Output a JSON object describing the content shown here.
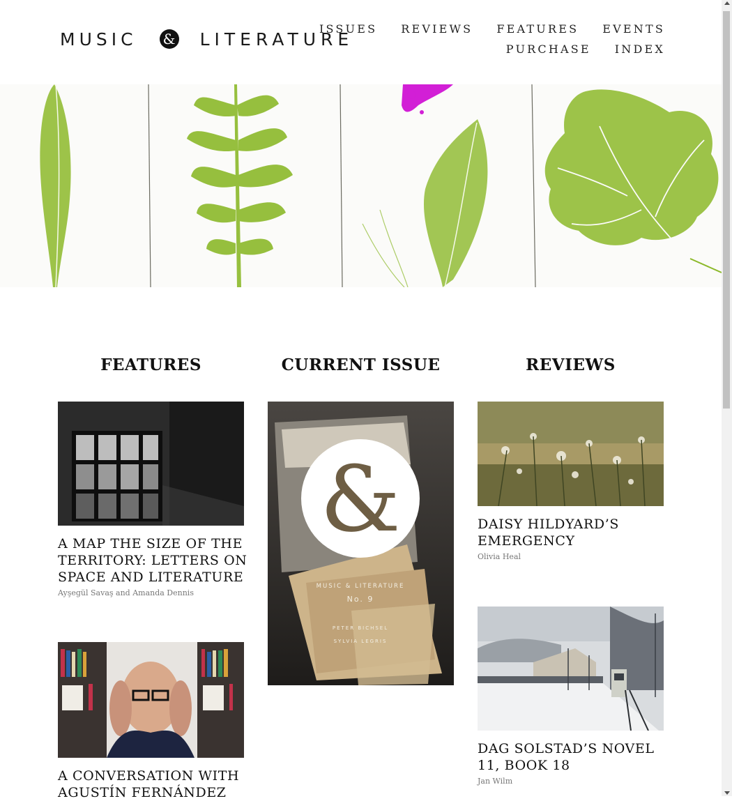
{
  "logo": {
    "word1": "MUSIC",
    "amp": "&",
    "word2": "LITERATURE"
  },
  "nav": {
    "row1": [
      "ISSUES",
      "REVIEWS",
      "FEATURES",
      "EVENTS"
    ],
    "row2": [
      "PURCHASE",
      "INDEX"
    ]
  },
  "sections": {
    "features": "FEATURES",
    "current_issue": "CURRENT ISSUE",
    "reviews": "REVIEWS"
  },
  "features": [
    {
      "title": "A MAP THE SIZE OF THE TERRITORY: LETTERS ON SPACE AND LITERATURE",
      "author": "Ayşegül Savaş and Amanda Dennis"
    },
    {
      "title": "A CONVERSATION WITH AGUSTÍN FERNÁNDEZ",
      "author": ""
    }
  ],
  "current_issue": {
    "cover_line1": "MUSIC & LITERATURE",
    "cover_line2": "No. 9",
    "cover_line3": "PETER BICHSEL",
    "cover_line4": "SYLVIA LEGRIS"
  },
  "reviews": [
    {
      "title": "DAISY HILDYARD’S EMERGENCY",
      "author": "Olivia Heal"
    },
    {
      "title": "DAG SOLSTAD’S NOVEL 11, BOOK 18",
      "author": "Jan Wilm"
    }
  ],
  "colors": {
    "leaf_green": "#8cb92a",
    "magenta": "#d21fd6",
    "text": "#111111",
    "author": "#777777"
  }
}
